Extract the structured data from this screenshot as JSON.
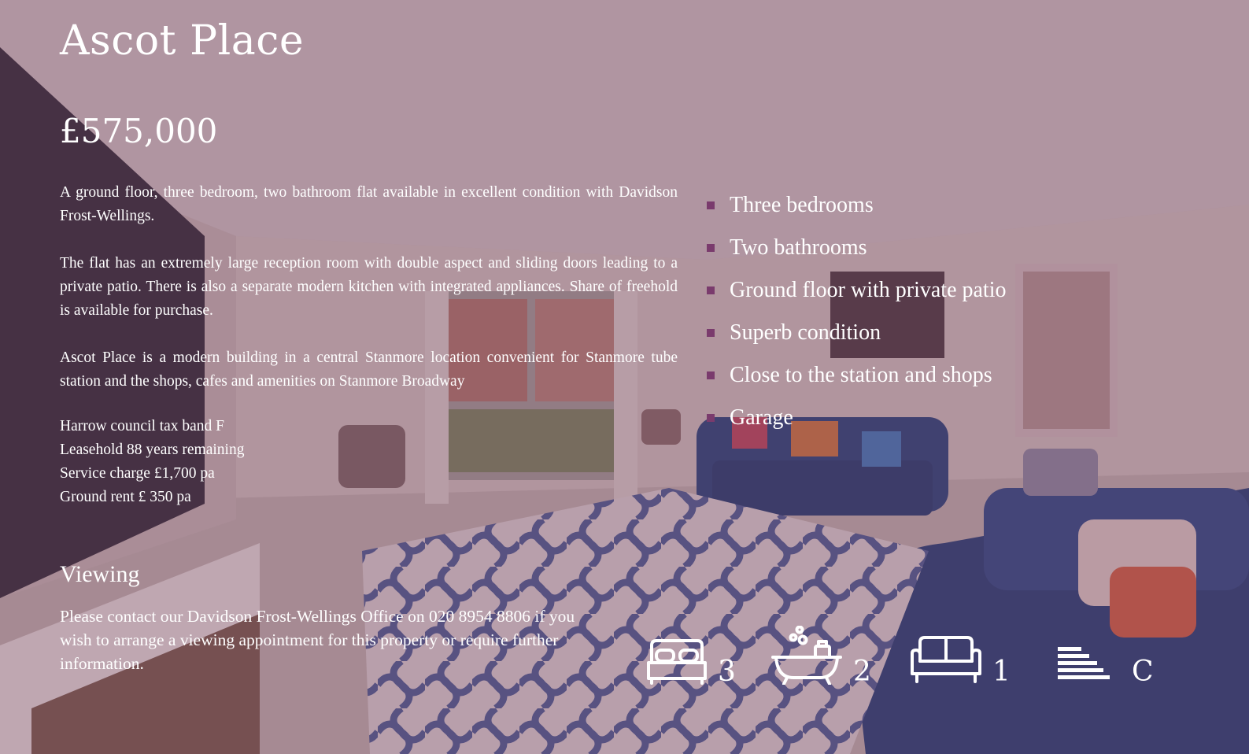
{
  "property": {
    "title": "Ascot Place",
    "price": "£575,000"
  },
  "description": {
    "paragraphs": [
      "A ground floor, three bedroom, two bathroom flat available in excellent condition with Davidson Frost-Wellings.",
      "The flat has an extremely large reception room with double aspect and sliding doors leading to a private patio. There is also a separate modern kitchen with integrated appliances. Share of freehold is available for purchase.",
      "Ascot Place is a modern building in a central Stanmore location convenient for Stanmore tube station and the shops, cafes and amenities on Stanmore Broadway"
    ],
    "details": [
      "Harrow council tax band F",
      "Leasehold 88 years remaining",
      "Service charge £1,700 pa",
      "Ground rent £ 350 pa"
    ]
  },
  "features": [
    "Three bedrooms",
    "Two bathrooms",
    "Ground floor with private patio",
    "Superb condition",
    "Close to the station and shops",
    "Garage"
  ],
  "viewing": {
    "heading": "Viewing",
    "text": "Please contact our Davidson Frost-Wellings Office on 020 8954 8806 if you wish to arrange a viewing appointment for this property or require further information."
  },
  "stats": [
    {
      "icon": "bed-icon",
      "value": "3"
    },
    {
      "icon": "bath-icon",
      "value": "2"
    },
    {
      "icon": "sofa-icon",
      "value": "1"
    },
    {
      "icon": "energy-rating-icon",
      "value": "C"
    }
  ],
  "colors": {
    "overlay": "#703c60",
    "bullet": "#7a3b6d",
    "text": "#ffffff"
  }
}
